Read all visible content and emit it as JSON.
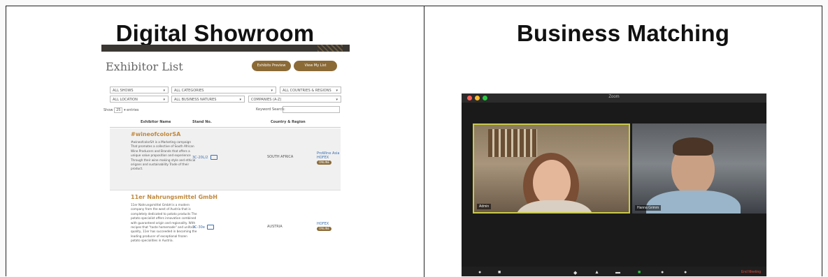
{
  "panels": {
    "left_title": "Digital Showroom",
    "right_title": "Business Matching"
  },
  "showroom": {
    "page_title": "Exhibitor List",
    "preview_button": "Exhibits Preview",
    "my_list_button": "View My List",
    "filters": {
      "shows": "ALL SHOWS",
      "categories": "ALL CATEGORIES",
      "countries": "ALL COUNTRIES & REGIONS",
      "location": "ALL LOCATION",
      "business_natures": "ALL BUSINESS NATURES",
      "companies": "COMPANIES (A-Z)"
    },
    "show_label": "Show",
    "show_count": "25",
    "entries_label": "entries",
    "keyword_label": "Keyword Search:",
    "columns": {
      "name": "Exhibitor Name",
      "stand": "Stand No.",
      "country": "Country & Region"
    },
    "rows": [
      {
        "name": "#wineofcolorSA",
        "description": "#wineofcolorSA is a Marketing campaign That promotes a collective of South African Wine Producers and Brands that offers a unique value proposition and experience Through their wine making style and ethical origans and sustainability Trade of their product.",
        "stand": "3C-20L/2",
        "country": "SOUTH AFRICA",
        "events": "ProWine Asia HOFEX",
        "tag": "ONLINE"
      },
      {
        "name": "11er Nahrungsmittel GmbH",
        "description": "11er Nahrungsmittel GmbH is a modern company from the west of Austria that is completely dedicated to potato products The potato specialist offers innovation combined with guaranteed origin and regionality. With recipes that \"taste homemade\" and uniform quality, 11er has succeeded in becoming the leading producer of exceptional frozen potato specialities in Austria.",
        "stand": "3C-30e",
        "country": "AUSTRIA",
        "events": "HOFEX",
        "tag": "ONLINE"
      }
    ]
  },
  "zoom": {
    "window_title": "Zoom",
    "left_participant": "Admin",
    "right_participant": "Hanna Grimm",
    "end_meeting": "End Meeting",
    "colors": {
      "active_speaker": "#c9c94a",
      "end": "#e04a3a",
      "close": "#fe5f57",
      "minimize": "#febc2e",
      "maximize": "#28c840"
    }
  }
}
